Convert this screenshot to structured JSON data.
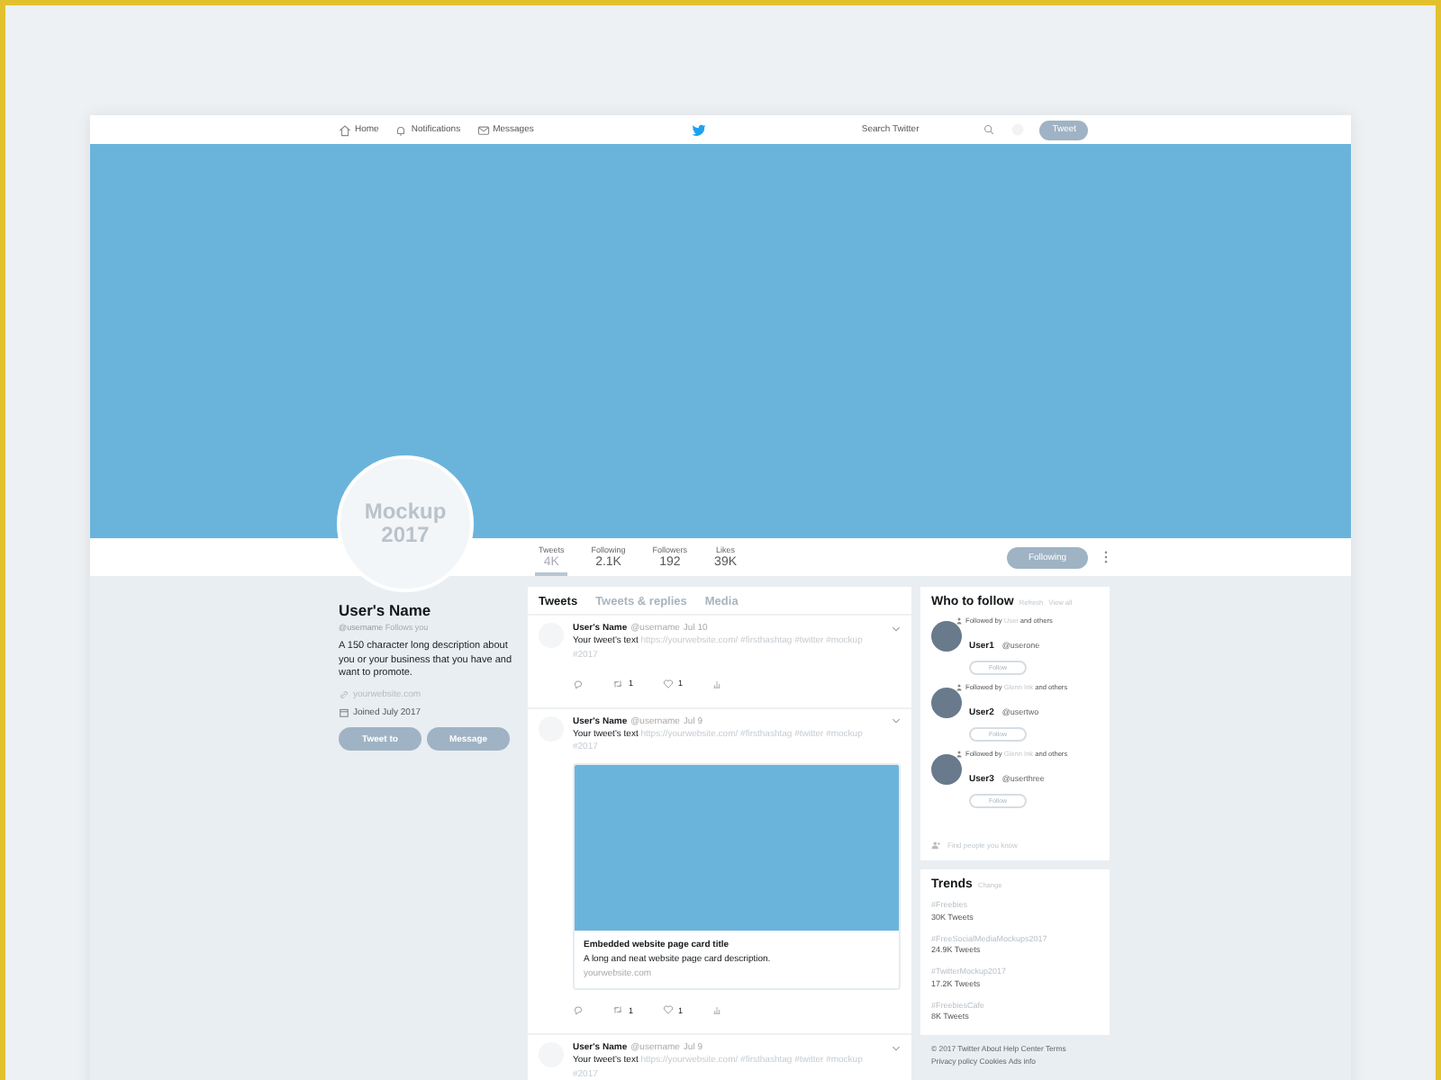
{
  "nav": {
    "items": [
      {
        "label": "Home"
      },
      {
        "label": "Notifications"
      },
      {
        "label": "Messages"
      }
    ],
    "search": {
      "placeholder": "Search Twitter"
    },
    "tweet_button": "Tweet"
  },
  "profile": {
    "avatar_text": [
      "Mockup",
      "2017"
    ],
    "name": "User's Name",
    "handle": "@username",
    "follows_you": "Follows you",
    "bio": "A 150 character long description about you or your business that you have and want to promote.",
    "website": "yourwebsite.com",
    "joined": "Joined July 2017",
    "buttons": [
      "Tweet to",
      "Message"
    ]
  },
  "stats": [
    {
      "label": "Tweets",
      "value": "4K",
      "selected": true
    },
    {
      "label": "Following",
      "value": "2.1K",
      "selected": false
    },
    {
      "label": "Followers",
      "value": "192",
      "selected": false
    },
    {
      "label": "Likes",
      "value": "39K",
      "selected": false
    }
  ],
  "follow_button": "Following",
  "tabs": [
    {
      "label": "Tweets",
      "selected": true
    },
    {
      "label": "Tweets & replies",
      "selected": false
    },
    {
      "label": "Media",
      "selected": false
    }
  ],
  "tweets": [
    {
      "name": "User's Name",
      "handle": "@username",
      "date": "Jul 10",
      "text": "Your tweet's text",
      "link": "https://yourwebsite.com/",
      "tags": "#firsthashtag #twitter #mockup #2017",
      "retweets": "1",
      "likes": "1"
    },
    {
      "name": "User's Name",
      "handle": "@username",
      "date": "Jul 9",
      "text": "Your tweet's text",
      "link": "https://yourwebsite.com/",
      "tags": "#firsthashtag #twitter #mockup #2017",
      "card": {
        "title": "Embedded website page card title",
        "description": "A long and neat website page card description.",
        "url": "yourwebsite.com"
      },
      "retweets": "1",
      "likes": "1"
    },
    {
      "name": "User's Name",
      "handle": "@username",
      "date": "Jul 9",
      "text": "Your tweet's text",
      "link": "https://yourwebsite.com/",
      "tags": "#firsthashtag #twitter #mockup #2017"
    }
  ],
  "who_to_follow": {
    "title": "Who to follow",
    "links": [
      "Refresh",
      "View all"
    ],
    "users": [
      {
        "followed_by": "Followed by",
        "by_name": "User",
        "others": "and others",
        "name": "User1",
        "handle": "@userone",
        "button": "Follow"
      },
      {
        "followed_by": "Followed by",
        "by_name": "Glenn Ink",
        "others": "and others",
        "name": "User2",
        "handle": "@usertwo",
        "button": "Follow"
      },
      {
        "followed_by": "Followed by",
        "by_name": "Glenn Ink",
        "others": "and others",
        "name": "User3",
        "handle": "@userthree",
        "button": "Follow"
      }
    ],
    "find": "Find people you know"
  },
  "trends": {
    "title": "Trends",
    "change": "Change",
    "items": [
      {
        "tag": "#Freebies",
        "count": "30K Tweets"
      },
      {
        "tag": "#FreeSocialMediaMockups2017",
        "count": "24.9K Tweets"
      },
      {
        "tag": "#TwitterMockup2017",
        "count": "17.2K Tweets"
      },
      {
        "tag": "#FreebiesCafe",
        "count": "8K Tweets"
      }
    ]
  },
  "footer": [
    "© 2017 Twitter About Help Center Terms",
    "Privacy policy Cookies Ads info"
  ]
}
